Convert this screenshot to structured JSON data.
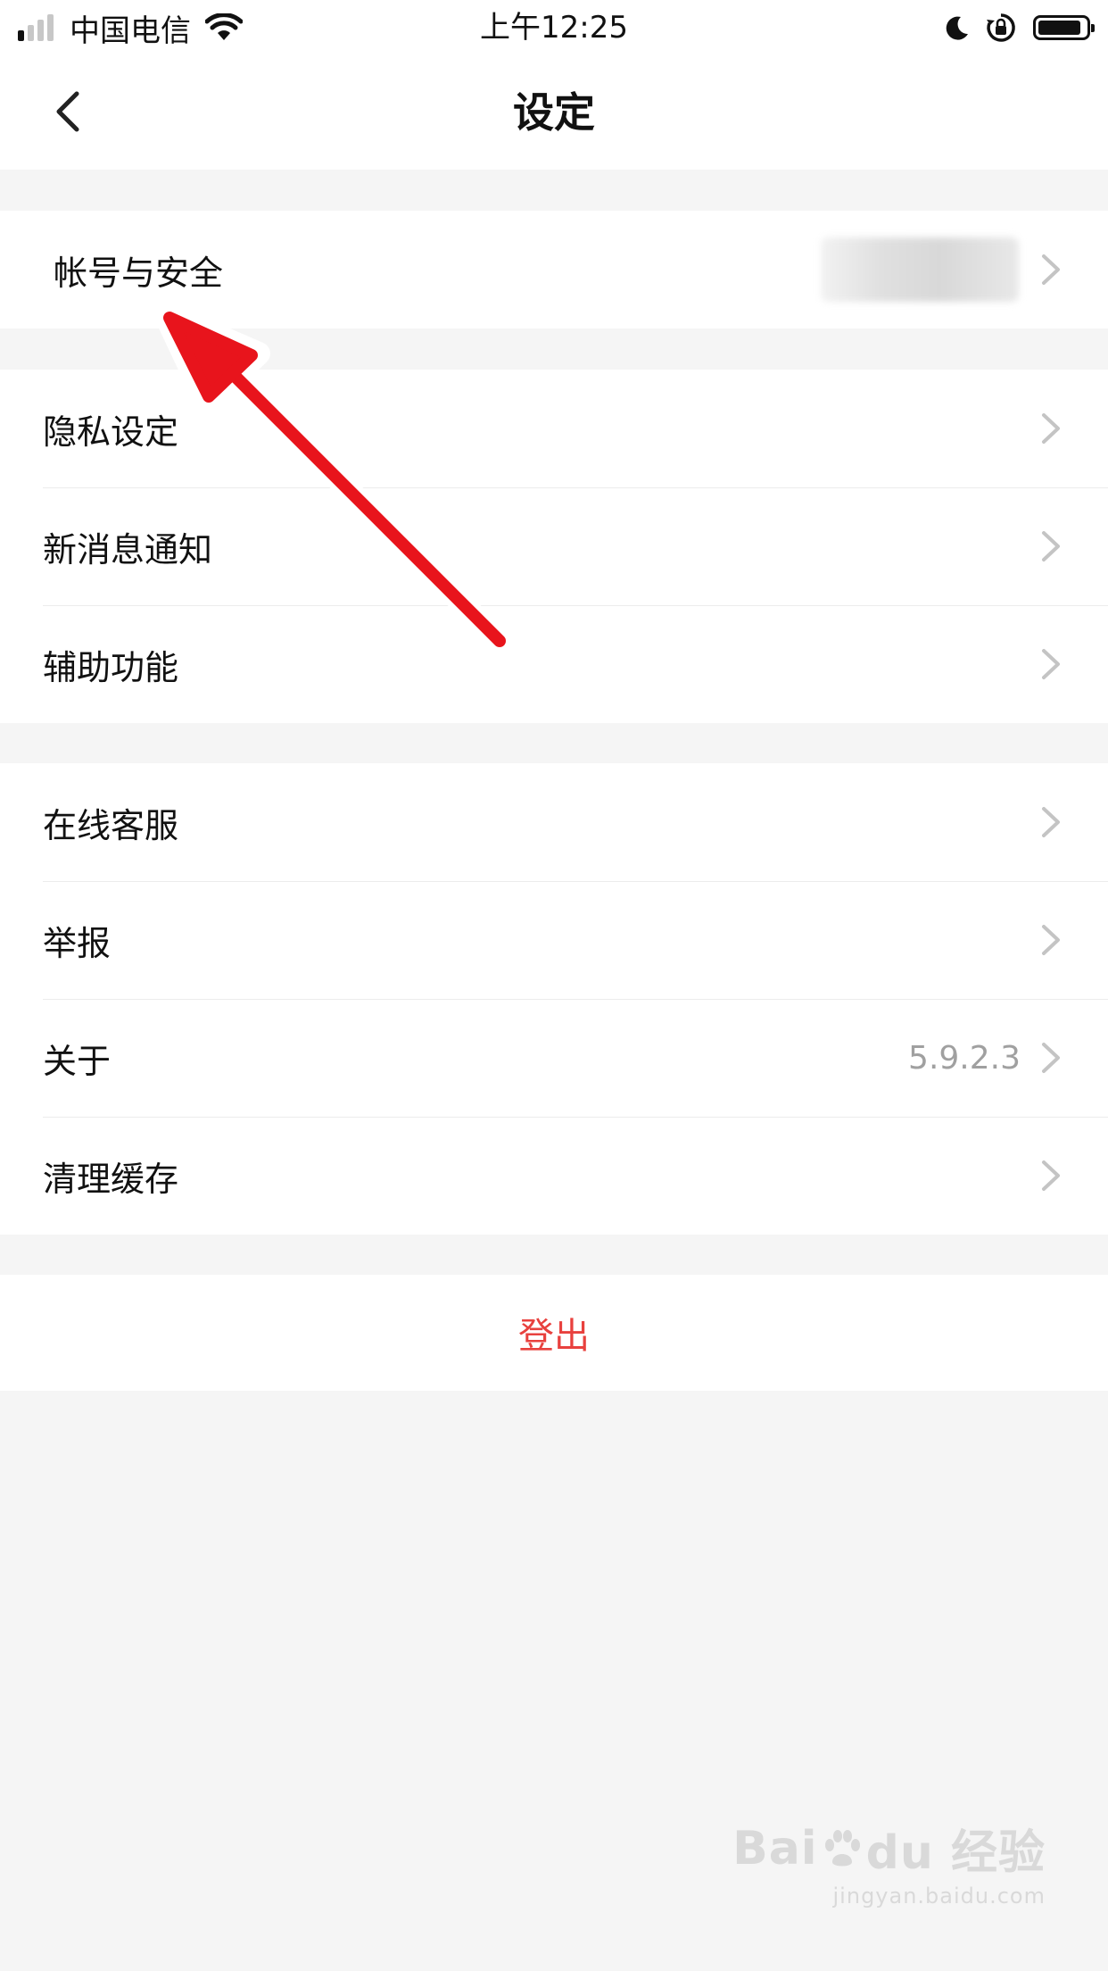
{
  "status_bar": {
    "carrier": "中国电信",
    "time": "上午12:25",
    "signal_bars_active": 1,
    "signal_bars_total": 4,
    "battery_level_percent": 90,
    "icons": [
      "wifi-icon",
      "moon-icon",
      "rotation-lock-icon",
      "battery-icon"
    ]
  },
  "nav": {
    "title": "设定",
    "back_icon": "chevron-left-icon"
  },
  "groups": [
    {
      "items": [
        {
          "label": "帐号与安全",
          "value": "",
          "value_obscured": true
        }
      ]
    },
    {
      "items": [
        {
          "label": "隐私设定",
          "value": ""
        },
        {
          "label": "新消息通知",
          "value": ""
        },
        {
          "label": "辅助功能",
          "value": ""
        }
      ]
    },
    {
      "items": [
        {
          "label": "在线客服",
          "value": ""
        },
        {
          "label": "举报",
          "value": ""
        },
        {
          "label": "关于",
          "value": "5.9.2.3"
        },
        {
          "label": "清理缓存",
          "value": ""
        }
      ]
    }
  ],
  "logout": {
    "label": "登出"
  },
  "watermark": {
    "brand": "Bai du 经验",
    "brand_left": "Bai",
    "brand_right": "du 经验",
    "url": "jingyan.baidu.com"
  },
  "colors": {
    "background": "#f5f5f5",
    "card": "#ffffff",
    "text": "#111111",
    "secondary_text": "#a0a0a0",
    "chevron": "#c4c4c4",
    "danger": "#e8413e",
    "annotation_arrow": "#e8141c"
  }
}
